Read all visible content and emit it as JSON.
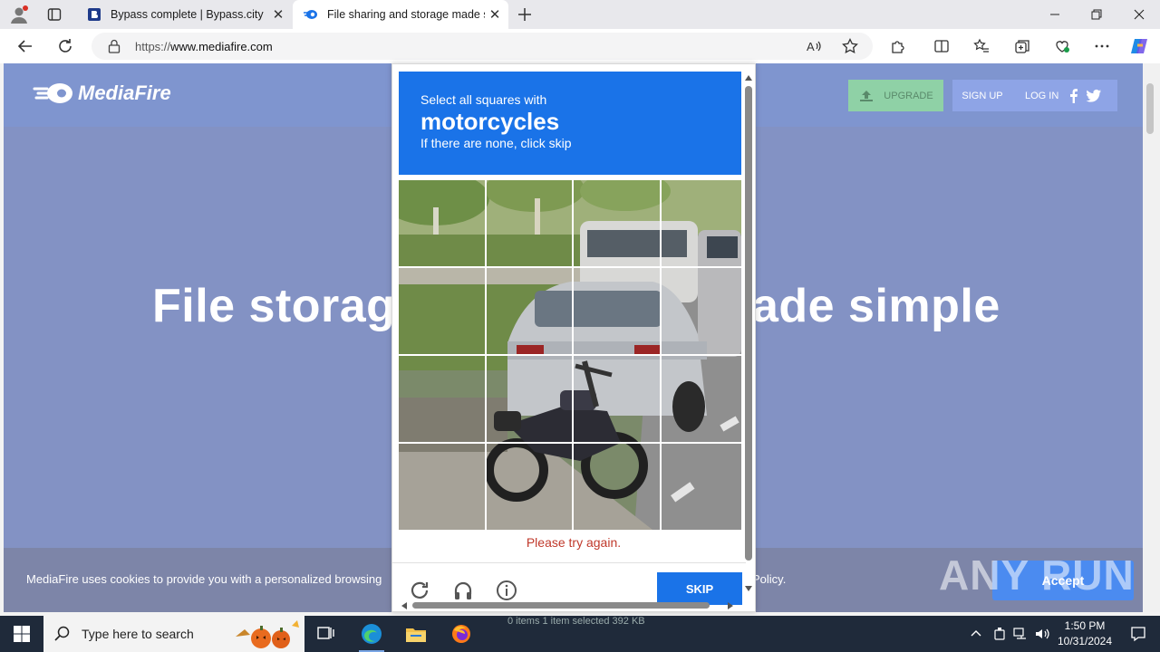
{
  "browser": {
    "tabs": [
      {
        "title": "Bypass complete | Bypass.city",
        "favicon": "bypass-favicon"
      },
      {
        "title": "File sharing and storage made simple",
        "favicon": "mediafire-favicon"
      }
    ],
    "url_prefix": "https://",
    "url_host": "www.mediafire.com",
    "window_controls": [
      "minimize",
      "restore",
      "close"
    ]
  },
  "mediafire": {
    "logo_text": "MediaFire",
    "upgrade_label": "UPGRADE",
    "signup_label": "SIGN UP",
    "login_label": "LOG IN",
    "hero_left": "File storag",
    "hero_right": "ade simple",
    "cookie_text": "MediaFire uses cookies to provide you with a personalized browsing",
    "cookie_policy_tail": "Policy.",
    "accept_label": "Accept"
  },
  "captcha": {
    "instruction": "Select all squares with",
    "target": "motorcycles",
    "hint": "If there are none, click skip",
    "error": "Please try again.",
    "skip_label": "SKIP",
    "grid_size": 4
  },
  "watermark": "ANY RUN",
  "taskbar": {
    "search_placeholder": "Type here to search",
    "time": "1:50 PM",
    "date": "10/31/2024",
    "behind_text": "0 items     1 item selected  392 KB"
  },
  "colors": {
    "captcha_blue": "#1a73e8",
    "page_overlay": "#8392c4",
    "upgrade_green": "#8fd1a6",
    "error_red": "#c0392b"
  }
}
